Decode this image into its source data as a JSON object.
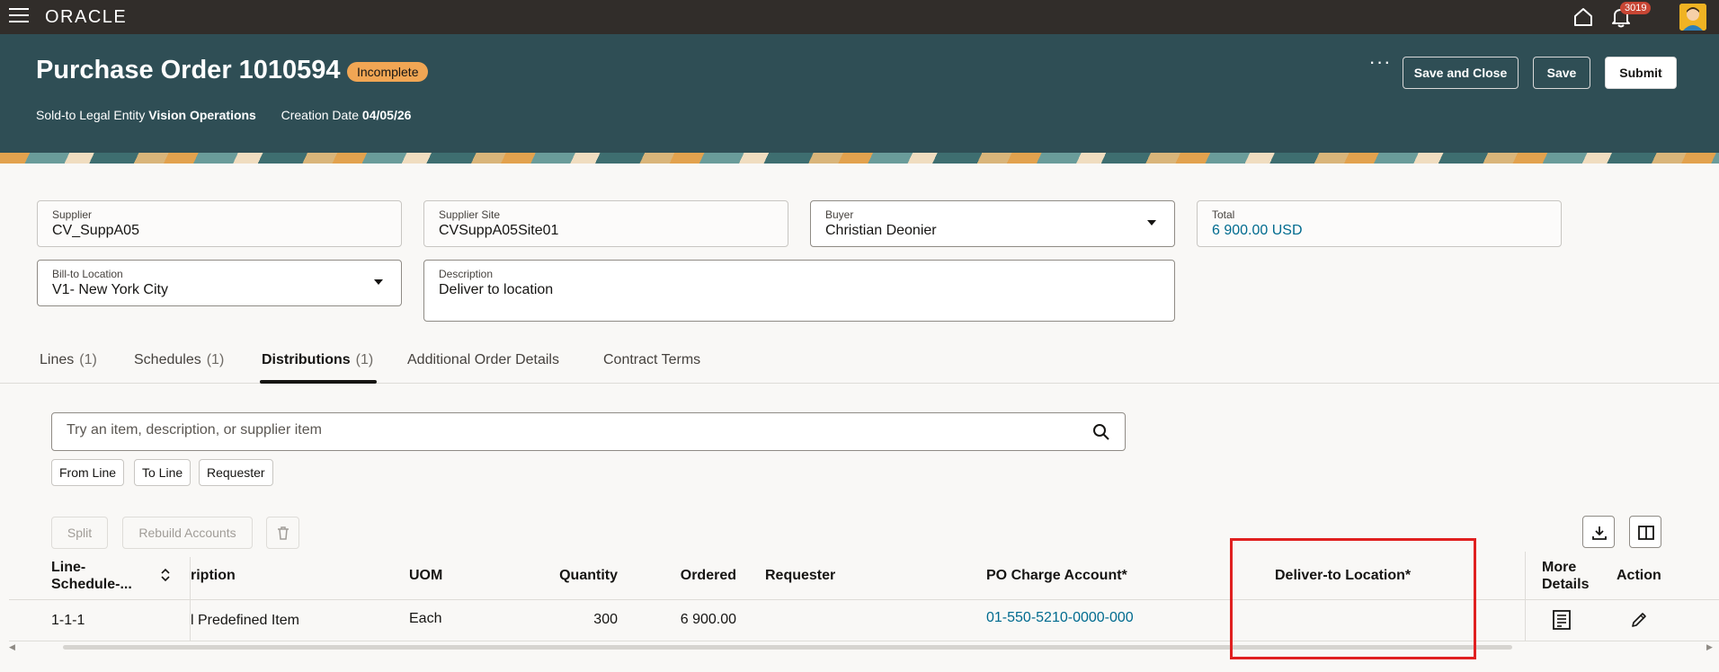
{
  "app": {
    "brand": "ORACLE",
    "notification_count": "3019"
  },
  "header": {
    "title": "Purchase Order 1010594",
    "status": "Incomplete",
    "legal_entity_label": "Sold-to Legal Entity",
    "legal_entity_value": "Vision Operations",
    "creation_date_label": "Creation Date",
    "creation_date_value": "04/05/26",
    "more_label": "···",
    "save_close_label": "Save and Close",
    "save_label": "Save",
    "submit_label": "Submit"
  },
  "form": {
    "supplier": {
      "label": "Supplier",
      "value": "CV_SuppA05"
    },
    "supplier_site": {
      "label": "Supplier Site",
      "value": "CVSuppA05Site01"
    },
    "buyer": {
      "label": "Buyer",
      "value": "Christian Deonier"
    },
    "total": {
      "label": "Total",
      "value": "6 900.00 USD"
    },
    "bill_to": {
      "label": "Bill-to Location",
      "value": "V1- New York City"
    },
    "description": {
      "label": "Description",
      "value": "Deliver to location"
    }
  },
  "tabs": [
    {
      "label": "Lines",
      "count": "(1)"
    },
    {
      "label": "Schedules",
      "count": "(1)"
    },
    {
      "label": "Distributions",
      "count": "(1)"
    },
    {
      "label": "Additional Order Details",
      "count": ""
    },
    {
      "label": "Contract Terms",
      "count": ""
    }
  ],
  "search": {
    "placeholder": "Try an item, description, or supplier item"
  },
  "filters": [
    "From Line",
    "To Line",
    "Requester"
  ],
  "toolbar": {
    "split_label": "Split",
    "rebuild_label": "Rebuild Accounts"
  },
  "table": {
    "headers": {
      "line": "Line-Schedule-...",
      "description": "ription",
      "uom": "UOM",
      "quantity": "Quantity",
      "ordered": "Ordered",
      "requester": "Requester",
      "charge_account": "PO Charge Account*",
      "deliver_to": "Deliver-to Location*",
      "more_details": "More Details",
      "action": "Action"
    },
    "rows": [
      {
        "line": "1-1-1",
        "description": "l Predefined Item",
        "uom": "Each",
        "quantity": "300",
        "ordered": "6 900.00",
        "requester": "",
        "charge_account": "01-550-5210-0000-000",
        "deliver_to": ""
      }
    ]
  },
  "colors": {
    "header_bg": "#2f4e55",
    "topbar_bg": "#312d2a",
    "status_badge": "#f1a654",
    "link": "#006b8f",
    "highlight": "#e02020"
  }
}
